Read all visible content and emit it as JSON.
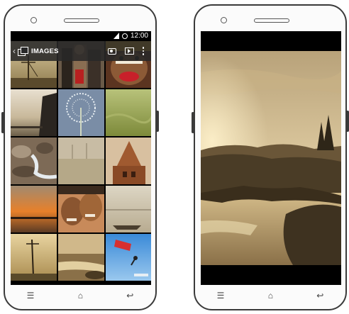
{
  "left_phone": {
    "status_bar": {
      "time": "12:00"
    },
    "action_bar": {
      "title": "IMAGES",
      "icons": [
        "back-chevron-icon",
        "albums-stack-icon",
        "camera-icon",
        "slideshow-icon",
        "overflow-menu-icon"
      ]
    },
    "gallery_tiles": [
      "tower-silhouette",
      "people-crowd",
      "painted-face",
      "dock-sunset",
      "dandelion-seedhead",
      "grass-field",
      "rocky-stream",
      "foggy-field",
      "temple-pagoda",
      "orange-sunset",
      "smiling-children",
      "pier-boat",
      "power-pole-field",
      "river-evening",
      "sky-diver"
    ]
  },
  "right_phone": {
    "photo": "river-landscape-sunset"
  },
  "nav_bar": {
    "menu_glyph": "☰",
    "home_glyph": "⌂",
    "back_glyph": "↩"
  },
  "colors": {
    "device_outline": "#3a3a3a",
    "action_bar": "#282828",
    "screen_bg": "#000000"
  }
}
